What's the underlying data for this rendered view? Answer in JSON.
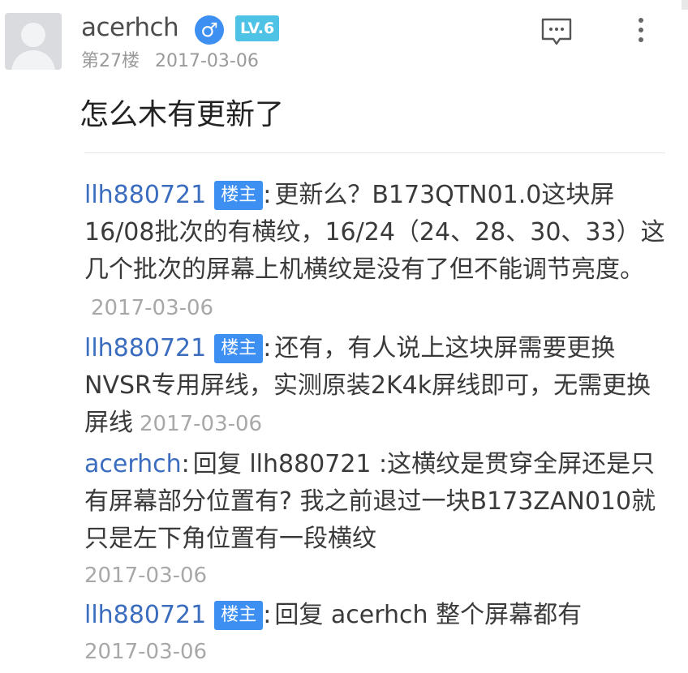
{
  "post": {
    "username": "acerhch",
    "gender_symbol": "♂",
    "level": "LV.6",
    "floor": "第27楼",
    "date": "2017-03-06",
    "content": "怎么木有更新了"
  },
  "comments": [
    {
      "author": "llh880721",
      "badge": "楼主",
      "colon": ":",
      "text": "更新么？B173QTN01.0这块屏16/08批次的有横纹，16/24（24、28、30、33）这几个批次的屏幕上机横纹是没有了但不能调节亮度。",
      "time": "2017-03-06"
    },
    {
      "author": "llh880721",
      "badge": "楼主",
      "colon": ":",
      "text": "还有，有人说上这块屏需要更换NVSR专用屏线，实测原装2K4k屏线即可，无需更换屏线",
      "time": "2017-03-06"
    },
    {
      "author": "acerhch",
      "colon": ":",
      "text": "回复 llh880721 :这横纹是贯穿全屏还是只有屏幕部分位置有? 我之前退过一块B173ZAN010就只是左下角位置有一段横纹",
      "time": "2017-03-06"
    },
    {
      "author": "llh880721",
      "badge": "楼主",
      "colon": ":",
      "text": "回复 acerhch 整个屏幕都有",
      "time": "2017-03-06"
    }
  ],
  "icons": {
    "reply": "comment-bubble-icon",
    "more": "more-vertical-icon"
  },
  "colors": {
    "link_blue": "#3b6dbf",
    "badge_blue": "#3e8ff2",
    "level_cyan": "#4fc3e6",
    "meta_gray": "#9a9a9a"
  }
}
